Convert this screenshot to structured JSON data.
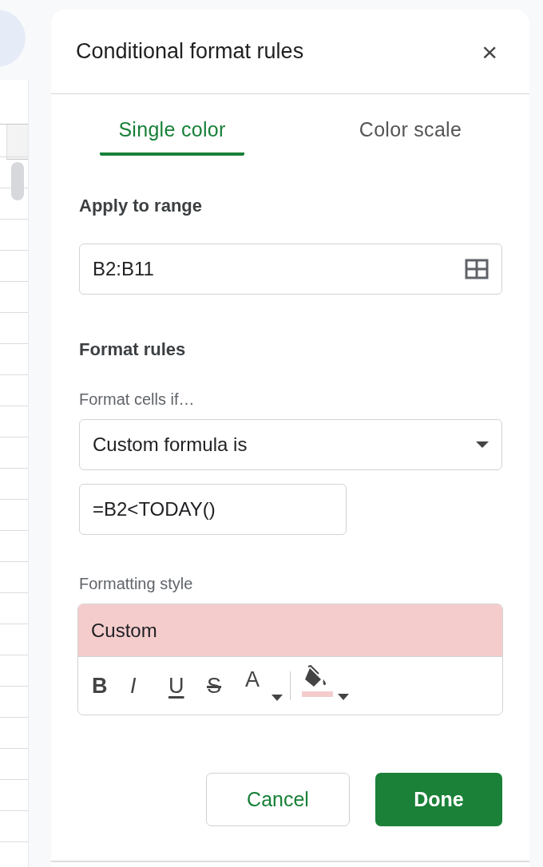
{
  "panel": {
    "title": "Conditional format rules",
    "close": "×"
  },
  "tabs": [
    {
      "label": "Single color",
      "selected": true
    },
    {
      "label": "Color scale",
      "selected": false
    }
  ],
  "range": {
    "label": "Apply to range",
    "value": "B2:B11"
  },
  "rules": {
    "heading": "Format rules",
    "condition_label": "Format cells if…",
    "condition": "Custom formula is",
    "formula": "=B2<TODAY()"
  },
  "style": {
    "label": "Formatting style",
    "preview": "Custom",
    "color": "#f4cccc",
    "toolbar": [
      {
        "kind": "bold",
        "label": "B"
      },
      {
        "kind": "italic",
        "label": "I"
      },
      {
        "kind": "underline",
        "label": "U"
      },
      {
        "kind": "strike",
        "label": "S"
      },
      {
        "kind": "text-color",
        "label": "A"
      },
      {
        "kind": "fill-color"
      }
    ]
  },
  "buttons": [
    {
      "kind": "secondary",
      "label": "Cancel"
    },
    {
      "kind": "primary",
      "label": "Done"
    }
  ]
}
